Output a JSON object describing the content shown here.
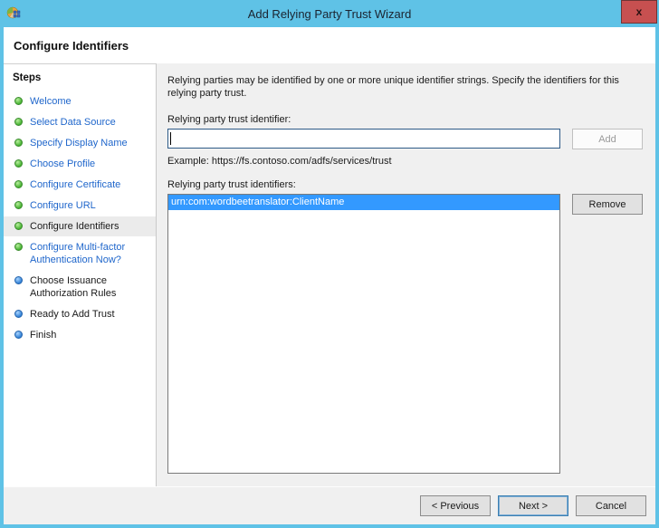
{
  "window": {
    "title": "Add Relying Party Trust Wizard",
    "close_glyph": "x"
  },
  "header": {
    "title": "Configure Identifiers"
  },
  "sidebar": {
    "title": "Steps",
    "items": [
      {
        "label": "Welcome",
        "state": "visited",
        "bullet": "green"
      },
      {
        "label": "Select Data Source",
        "state": "visited",
        "bullet": "green"
      },
      {
        "label": "Specify Display Name",
        "state": "visited",
        "bullet": "green"
      },
      {
        "label": "Choose Profile",
        "state": "visited",
        "bullet": "green"
      },
      {
        "label": "Configure Certificate",
        "state": "visited",
        "bullet": "green"
      },
      {
        "label": "Configure URL",
        "state": "visited",
        "bullet": "green"
      },
      {
        "label": "Configure Identifiers",
        "state": "current",
        "bullet": "green"
      },
      {
        "label": "Configure Multi-factor Authentication Now?",
        "state": "visited",
        "bullet": "green"
      },
      {
        "label": "Choose Issuance Authorization Rules",
        "state": "upcoming",
        "bullet": "blue"
      },
      {
        "label": "Ready to Add Trust",
        "state": "upcoming",
        "bullet": "blue"
      },
      {
        "label": "Finish",
        "state": "upcoming",
        "bullet": "blue"
      }
    ]
  },
  "content": {
    "intro": "Relying parties may be identified by one or more unique identifier strings. Specify the identifiers for this relying party trust.",
    "identifier_label": "Relying party trust identifier:",
    "identifier_value": "",
    "add_button": "Add",
    "example": "Example: https://fs.contoso.com/adfs/services/trust",
    "identifiers_label": "Relying party trust identifiers:",
    "identifiers": [
      "urn:com:wordbeetranslator:ClientName"
    ],
    "remove_button": "Remove"
  },
  "footer": {
    "previous_button": "< Previous",
    "next_button": "Next >",
    "cancel_button": "Cancel"
  },
  "colors": {
    "titlebar_blue": "#5fc2e6",
    "close_red": "#c75050",
    "link_blue": "#1f66cb",
    "bullet_green": "#3fae2a",
    "bullet_blue": "#2b7cd3",
    "selection_blue": "#3399ff",
    "content_gray": "#f0f0f0",
    "input_focus_border": "#2d5a87",
    "default_button_border": "#3c7fb1"
  }
}
